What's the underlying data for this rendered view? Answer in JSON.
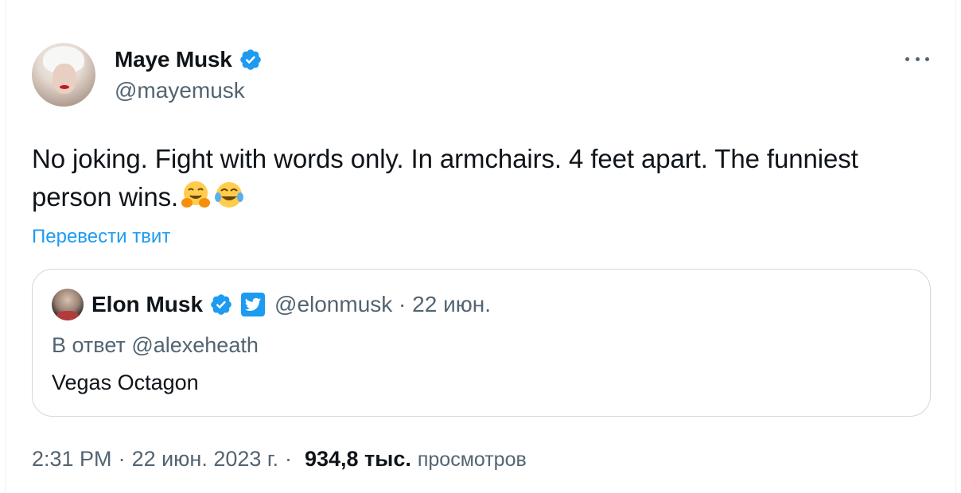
{
  "author": {
    "display_name": "Maye Musk",
    "handle": "@mayemusk",
    "verified": true
  },
  "tweet": {
    "text": "No joking. Fight with words only. In armchairs. 4 feet apart.  The funniest person wins.",
    "emojis": [
      "hugging-face",
      "face-with-tears-of-joy"
    ],
    "translate_label": "Перевести твит"
  },
  "quoted_tweet": {
    "display_name": "Elon Musk",
    "handle": "@elonmusk",
    "date": "22 июн.",
    "reply_to": "В ответ @alexeheath",
    "text": "Vegas Octagon"
  },
  "footer": {
    "time": "2:31 PM",
    "date": "22 июн. 2023 г.",
    "views_count": "934,8 тыс.",
    "views_label": "просмотров"
  },
  "colors": {
    "accent": "#1d9bf0",
    "text_primary": "#0f1419",
    "text_secondary": "#536471",
    "border": "#cfd9de"
  }
}
